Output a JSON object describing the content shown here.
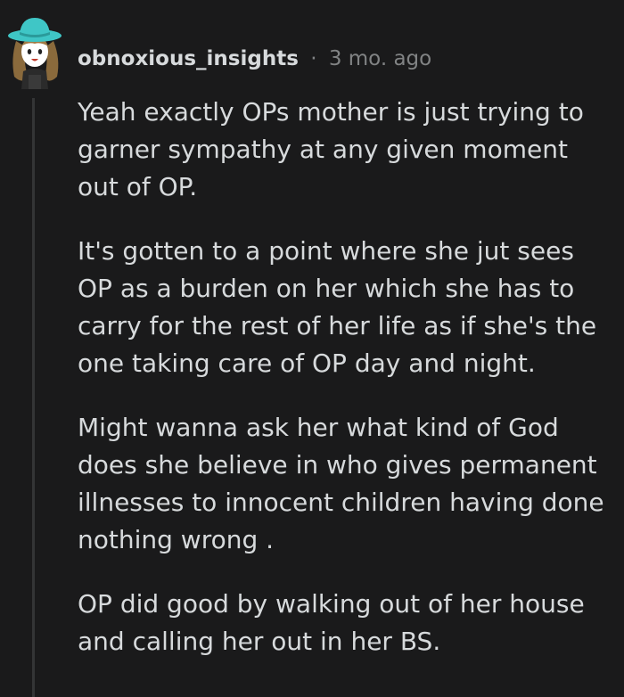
{
  "comment": {
    "author": "obnoxious_insights",
    "separator": "·",
    "age": "3 mo. ago",
    "avatar_icon": "cartoon-avatar-icon",
    "paragraphs": [
      "Yeah exactly OPs mother is just trying to garner sympathy at any given moment out of OP.",
      "It's gotten to a point where she jut sees OP as a burden on her which she has to carry for the rest of her life as if she's the one taking care of OP day and night.",
      "Might wanna ask her what kind of God does she believe in who gives permanent illnesses to innocent children having done nothing wrong .",
      "OP did good by walking out of her house and calling her out in her BS."
    ]
  },
  "colors": {
    "background": "#1a1a1b",
    "text": "#d7dadc",
    "meta": "#818384",
    "thread_line": "#343536",
    "hat": "#3fc6c6"
  }
}
